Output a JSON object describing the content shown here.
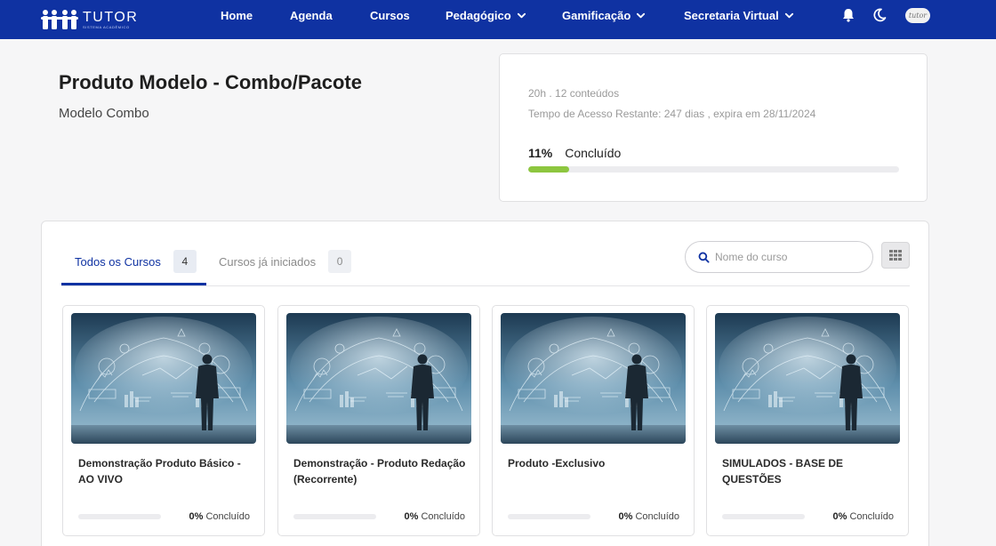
{
  "nav": {
    "logo_text": "TUTOR",
    "logo_subtext": "SISTEMA ACADÊMICO",
    "items": [
      {
        "label": "Home"
      },
      {
        "label": "Agenda"
      },
      {
        "label": "Cursos"
      },
      {
        "label": "Pedagógico",
        "icon": "chevron-down-icon"
      },
      {
        "label": "Gamificação",
        "icon": "chevron-down-icon"
      },
      {
        "label": "Secretaria Virtual",
        "icon": "chevron-down-icon"
      }
    ],
    "avatar_text": "tutor",
    "icons": [
      "bell-icon",
      "moon-icon"
    ]
  },
  "header": {
    "title": "Produto Modelo - Combo/Pacote",
    "subtitle": "Modelo Combo"
  },
  "info": {
    "meta": "20h . 12 conteúdos",
    "access": "Tempo de Acesso Restante: 247 dias , expira em 28/11/2024",
    "progress_pct": "11%",
    "progress_label": "Concluído",
    "progress_value": 11
  },
  "tabs": [
    {
      "label": "Todos os Cursos",
      "count": "4",
      "active": true
    },
    {
      "label": "Cursos já iniciados",
      "count": "0",
      "active": false
    }
  ],
  "search": {
    "placeholder": "Nome do curso",
    "value": ""
  },
  "courses": [
    {
      "title": "Demonstração Produto Básico - AO VIVO",
      "progress_pct": "0%",
      "progress_label": "Concluído",
      "progress_value": 0
    },
    {
      "title": "Demonstração - Produto Redação (Recorrente)",
      "progress_pct": "0%",
      "progress_label": "Concluído",
      "progress_value": 0
    },
    {
      "title": "Produto -Exclusivo",
      "progress_pct": "0%",
      "progress_label": "Concluído",
      "progress_value": 0
    },
    {
      "title": "SIMULADOS - BASE DE QUESTÕES",
      "progress_pct": "0%",
      "progress_label": "Concluído",
      "progress_value": 0
    }
  ],
  "colors": {
    "brand": "#0f32a2",
    "progress": "#8dc63f"
  }
}
